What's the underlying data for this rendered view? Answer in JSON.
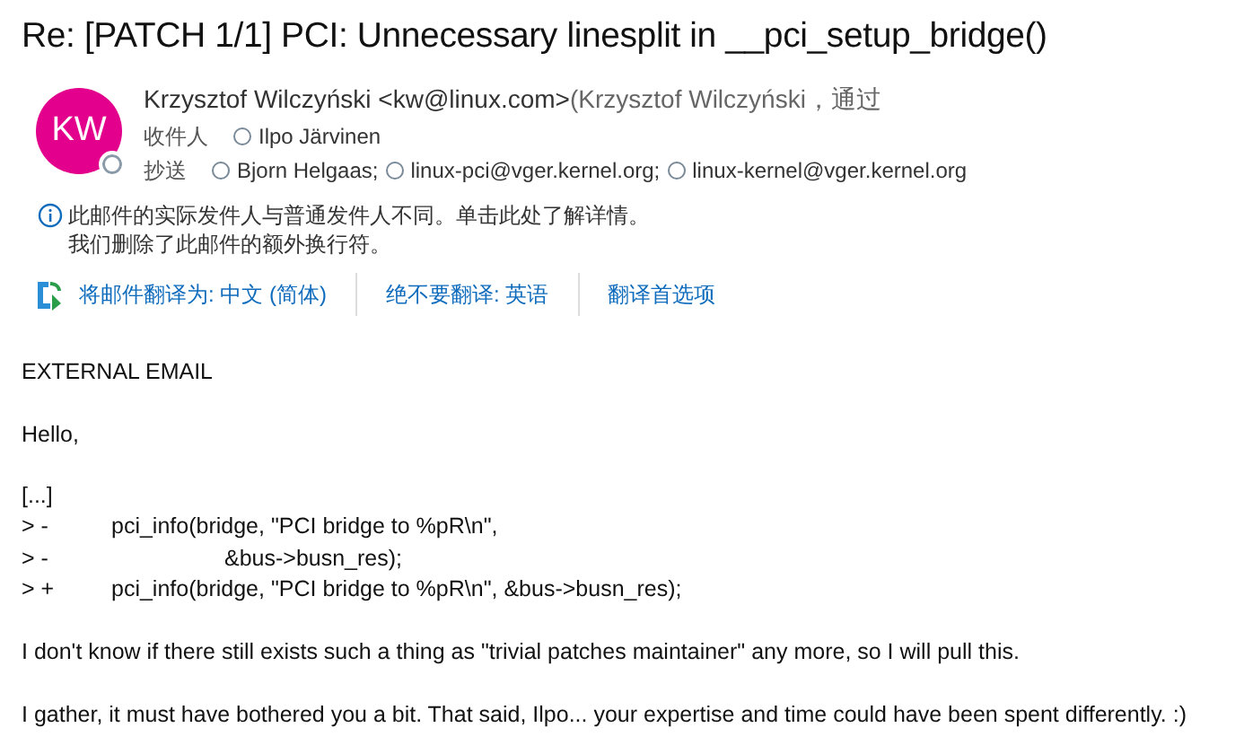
{
  "subject": "Re: [PATCH 1/1] PCI: Unnecessary linesplit in __pci_setup_bridge()",
  "sender": {
    "initials": "KW",
    "color": "#e3008c",
    "name": "Krzysztof Wilczyński <kw@linux.com>",
    "via": "(Krzysztof Wilczyński，通过"
  },
  "to": {
    "label": "收件人",
    "recipients": [
      "Ilpo Järvinen"
    ]
  },
  "cc": {
    "label": "抄送",
    "recipients": [
      "Bjorn Helgaas;",
      "linux-pci@vger.kernel.org;",
      "linux-kernel@vger.kernel.org"
    ]
  },
  "notices": [
    "此邮件的实际发件人与普通发件人不同。单击此处了解详情。",
    "我们删除了此邮件的额外换行符。"
  ],
  "translate_bar": [
    "将邮件翻译为: 中文 (简体)",
    "绝不要翻译: 英语",
    "翻译首选项"
  ],
  "body": [
    {
      "kind": "paragraph",
      "text": "EXTERNAL EMAIL"
    },
    {
      "kind": "paragraph",
      "text": "Hello,"
    },
    {
      "kind": "line",
      "text": "[...]"
    },
    {
      "kind": "diff",
      "prefix": "> -",
      "code": "pci_info(bridge, \"PCI bridge to %pR\\n\","
    },
    {
      "kind": "diff-continued",
      "prefix": "> -",
      "code": "&bus->busn_res);"
    },
    {
      "kind": "diff",
      "prefix": "> +",
      "code": "pci_info(bridge, \"PCI bridge to %pR\\n\", &bus->busn_res);"
    },
    {
      "kind": "paragraph",
      "text": "I don't know if there still exists such a thing as \"trivial patches maintainer\" any more, so I will pull this."
    },
    {
      "kind": "paragraph",
      "text": "I gather, it must have bothered you a bit. That said, Ilpo... your expertise and time could have been spent differently. :)"
    }
  ]
}
